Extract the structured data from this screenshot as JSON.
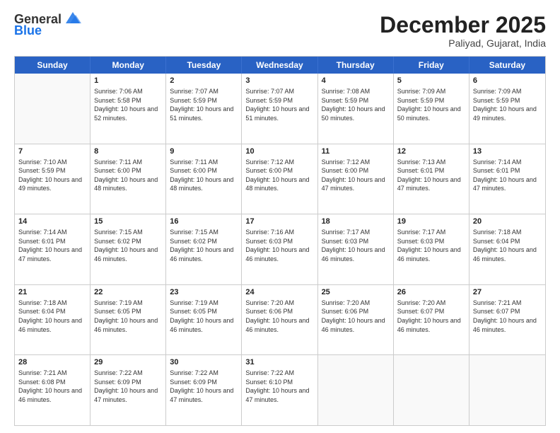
{
  "logo": {
    "line1": "General",
    "line2": "Blue"
  },
  "title": "December 2025",
  "subtitle": "Paliyad, Gujarat, India",
  "header_days": [
    "Sunday",
    "Monday",
    "Tuesday",
    "Wednesday",
    "Thursday",
    "Friday",
    "Saturday"
  ],
  "weeks": [
    [
      {
        "day": "",
        "empty": true
      },
      {
        "day": "1",
        "sunrise": "Sunrise: 7:06 AM",
        "sunset": "Sunset: 5:58 PM",
        "daylight": "Daylight: 10 hours and 52 minutes."
      },
      {
        "day": "2",
        "sunrise": "Sunrise: 7:07 AM",
        "sunset": "Sunset: 5:59 PM",
        "daylight": "Daylight: 10 hours and 51 minutes."
      },
      {
        "day": "3",
        "sunrise": "Sunrise: 7:07 AM",
        "sunset": "Sunset: 5:59 PM",
        "daylight": "Daylight: 10 hours and 51 minutes."
      },
      {
        "day": "4",
        "sunrise": "Sunrise: 7:08 AM",
        "sunset": "Sunset: 5:59 PM",
        "daylight": "Daylight: 10 hours and 50 minutes."
      },
      {
        "day": "5",
        "sunrise": "Sunrise: 7:09 AM",
        "sunset": "Sunset: 5:59 PM",
        "daylight": "Daylight: 10 hours and 50 minutes."
      },
      {
        "day": "6",
        "sunrise": "Sunrise: 7:09 AM",
        "sunset": "Sunset: 5:59 PM",
        "daylight": "Daylight: 10 hours and 49 minutes."
      }
    ],
    [
      {
        "day": "7",
        "sunrise": "Sunrise: 7:10 AM",
        "sunset": "Sunset: 5:59 PM",
        "daylight": "Daylight: 10 hours and 49 minutes."
      },
      {
        "day": "8",
        "sunrise": "Sunrise: 7:11 AM",
        "sunset": "Sunset: 6:00 PM",
        "daylight": "Daylight: 10 hours and 48 minutes."
      },
      {
        "day": "9",
        "sunrise": "Sunrise: 7:11 AM",
        "sunset": "Sunset: 6:00 PM",
        "daylight": "Daylight: 10 hours and 48 minutes."
      },
      {
        "day": "10",
        "sunrise": "Sunrise: 7:12 AM",
        "sunset": "Sunset: 6:00 PM",
        "daylight": "Daylight: 10 hours and 48 minutes."
      },
      {
        "day": "11",
        "sunrise": "Sunrise: 7:12 AM",
        "sunset": "Sunset: 6:00 PM",
        "daylight": "Daylight: 10 hours and 47 minutes."
      },
      {
        "day": "12",
        "sunrise": "Sunrise: 7:13 AM",
        "sunset": "Sunset: 6:01 PM",
        "daylight": "Daylight: 10 hours and 47 minutes."
      },
      {
        "day": "13",
        "sunrise": "Sunrise: 7:14 AM",
        "sunset": "Sunset: 6:01 PM",
        "daylight": "Daylight: 10 hours and 47 minutes."
      }
    ],
    [
      {
        "day": "14",
        "sunrise": "Sunrise: 7:14 AM",
        "sunset": "Sunset: 6:01 PM",
        "daylight": "Daylight: 10 hours and 47 minutes."
      },
      {
        "day": "15",
        "sunrise": "Sunrise: 7:15 AM",
        "sunset": "Sunset: 6:02 PM",
        "daylight": "Daylight: 10 hours and 46 minutes."
      },
      {
        "day": "16",
        "sunrise": "Sunrise: 7:15 AM",
        "sunset": "Sunset: 6:02 PM",
        "daylight": "Daylight: 10 hours and 46 minutes."
      },
      {
        "day": "17",
        "sunrise": "Sunrise: 7:16 AM",
        "sunset": "Sunset: 6:03 PM",
        "daylight": "Daylight: 10 hours and 46 minutes."
      },
      {
        "day": "18",
        "sunrise": "Sunrise: 7:17 AM",
        "sunset": "Sunset: 6:03 PM",
        "daylight": "Daylight: 10 hours and 46 minutes."
      },
      {
        "day": "19",
        "sunrise": "Sunrise: 7:17 AM",
        "sunset": "Sunset: 6:03 PM",
        "daylight": "Daylight: 10 hours and 46 minutes."
      },
      {
        "day": "20",
        "sunrise": "Sunrise: 7:18 AM",
        "sunset": "Sunset: 6:04 PM",
        "daylight": "Daylight: 10 hours and 46 minutes."
      }
    ],
    [
      {
        "day": "21",
        "sunrise": "Sunrise: 7:18 AM",
        "sunset": "Sunset: 6:04 PM",
        "daylight": "Daylight: 10 hours and 46 minutes."
      },
      {
        "day": "22",
        "sunrise": "Sunrise: 7:19 AM",
        "sunset": "Sunset: 6:05 PM",
        "daylight": "Daylight: 10 hours and 46 minutes."
      },
      {
        "day": "23",
        "sunrise": "Sunrise: 7:19 AM",
        "sunset": "Sunset: 6:05 PM",
        "daylight": "Daylight: 10 hours and 46 minutes."
      },
      {
        "day": "24",
        "sunrise": "Sunrise: 7:20 AM",
        "sunset": "Sunset: 6:06 PM",
        "daylight": "Daylight: 10 hours and 46 minutes."
      },
      {
        "day": "25",
        "sunrise": "Sunrise: 7:20 AM",
        "sunset": "Sunset: 6:06 PM",
        "daylight": "Daylight: 10 hours and 46 minutes."
      },
      {
        "day": "26",
        "sunrise": "Sunrise: 7:20 AM",
        "sunset": "Sunset: 6:07 PM",
        "daylight": "Daylight: 10 hours and 46 minutes."
      },
      {
        "day": "27",
        "sunrise": "Sunrise: 7:21 AM",
        "sunset": "Sunset: 6:07 PM",
        "daylight": "Daylight: 10 hours and 46 minutes."
      }
    ],
    [
      {
        "day": "28",
        "sunrise": "Sunrise: 7:21 AM",
        "sunset": "Sunset: 6:08 PM",
        "daylight": "Daylight: 10 hours and 46 minutes."
      },
      {
        "day": "29",
        "sunrise": "Sunrise: 7:22 AM",
        "sunset": "Sunset: 6:09 PM",
        "daylight": "Daylight: 10 hours and 47 minutes."
      },
      {
        "day": "30",
        "sunrise": "Sunrise: 7:22 AM",
        "sunset": "Sunset: 6:09 PM",
        "daylight": "Daylight: 10 hours and 47 minutes."
      },
      {
        "day": "31",
        "sunrise": "Sunrise: 7:22 AM",
        "sunset": "Sunset: 6:10 PM",
        "daylight": "Daylight: 10 hours and 47 minutes."
      },
      {
        "day": "",
        "empty": true
      },
      {
        "day": "",
        "empty": true
      },
      {
        "day": "",
        "empty": true
      }
    ]
  ]
}
